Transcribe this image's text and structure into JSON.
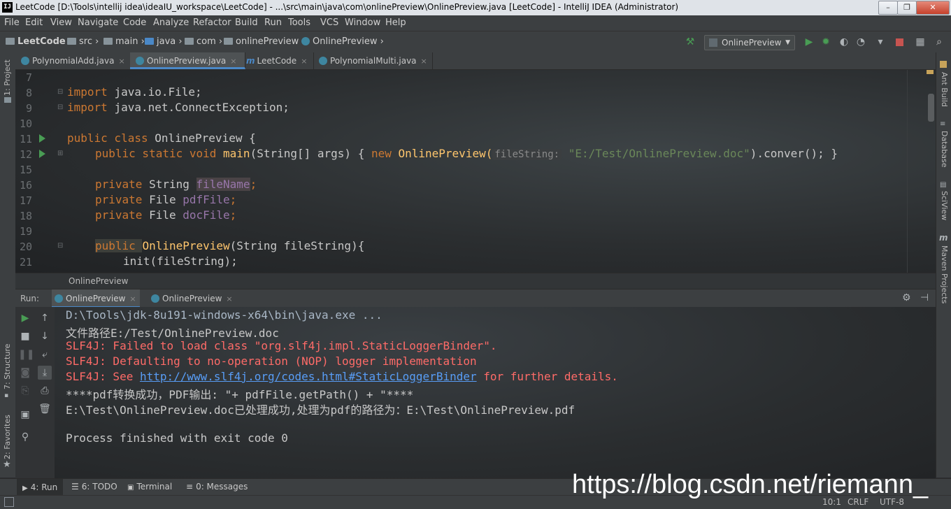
{
  "window": {
    "title": "LeetCode [D:\\Tools\\intellij idea\\ideaIU_workspace\\LeetCode] - ...\\src\\main\\java\\com\\onlinePreview\\OnlinePreview.java [LeetCode] - IntelliJ IDEA (Administrator)",
    "logo": "IJ",
    "minimize": "–",
    "restore": "❐",
    "close": "✕"
  },
  "menu": [
    "File",
    "Edit",
    "View",
    "Navigate",
    "Code",
    "Analyze",
    "Refactor",
    "Build",
    "Run",
    "Tools",
    "VCS",
    "Window",
    "Help"
  ],
  "breadcrumbs": [
    "LeetCode",
    "src",
    "main",
    "java",
    "com",
    "onlinePreview",
    "OnlinePreview"
  ],
  "run_config": "OnlinePreview",
  "left_tool_windows": [
    "1: Project",
    "7: Structure",
    "2: Favorites"
  ],
  "right_tool_windows": [
    "Ant Build",
    "Database",
    "SciView",
    "Maven Projects"
  ],
  "tabs": [
    {
      "label": "PolynomialAdd.java",
      "icon": "class-icon"
    },
    {
      "label": "OnlinePreview.java",
      "icon": "class-icon",
      "active": true
    },
    {
      "label": "LeetCode",
      "icon": "maven-icon"
    },
    {
      "label": "PolynomialMulti.java",
      "icon": "class-icon"
    }
  ],
  "editor": {
    "line_numbers": [
      "7",
      "8",
      "9",
      "10",
      "11",
      "12",
      "15",
      "16",
      "17",
      "18",
      "19",
      "20",
      "21"
    ],
    "lines": {
      "l8_kw": "import ",
      "l8_rest": "java.io.File;",
      "l9_kw": "import ",
      "l9_rest": "java.net.ConnectException;",
      "l11_kw": "public class ",
      "l11_rest": "OnlinePreview {",
      "l12_kw1": "public static void ",
      "l12_fn": "main",
      "l12_a": "(String[] args) { ",
      "l12_kw2": "new ",
      "l12_b": "OnlinePreview(",
      "l12_hint": "fileString:",
      "l12_str": "\"E:/Test/OnlinePreview.doc\"",
      "l12_c": ").conver(); }",
      "l16_kw": "private ",
      "l16_type": "String ",
      "l16_fld": "fileName",
      "l16_end": ";",
      "l17_kw": "private ",
      "l17_type": "File ",
      "l17_fld": "pdfFile",
      "l17_end": ";",
      "l18_kw": "private ",
      "l18_type": "File ",
      "l18_fld": "docFile",
      "l18_end": ";",
      "l20_kw": "public ",
      "l20_fn": "OnlinePreview",
      "l20_rest": "(String fileString){",
      "l21": "init(fileString);"
    }
  },
  "editor_breadcrumb": "OnlinePreview",
  "run_panel": {
    "label": "Run:",
    "tabs": [
      "OnlinePreview",
      "OnlinePreview"
    ],
    "console": [
      {
        "text": "D:\\Tools\\jdk-8u191-windows-x64\\bin\\java.exe ...",
        "kind": "cmd"
      },
      {
        "text": "文件路径E:/Test/OnlinePreview.doc",
        "kind": "out"
      },
      {
        "text": "SLF4J: Failed to load class \"org.slf4j.impl.StaticLoggerBinder\".",
        "kind": "err"
      },
      {
        "text": "SLF4J: Defaulting to no-operation (NOP) logger implementation",
        "kind": "err"
      },
      {
        "text": "SLF4J: See ",
        "kind": "err",
        "link": "http://www.slf4j.org/codes.html#StaticLoggerBinder",
        "tail": " for further details."
      },
      {
        "text": "****pdf转换成功，PDF输出: \"+ pdfFile.getPath() + \"****",
        "kind": "out"
      },
      {
        "text": "E:\\Test\\OnlinePreview.doc已处理成功,处理为pdf的路径为：E:\\Test\\OnlinePreview.pdf",
        "kind": "out"
      },
      {
        "text": "",
        "kind": "out"
      },
      {
        "text": "Process finished with exit code 0",
        "kind": "out"
      }
    ]
  },
  "bottom_tabs": [
    "4: Run",
    "6: TODO",
    "Terminal",
    "0: Messages"
  ],
  "status": {
    "position": "10:1",
    "line_sep": "CRLF",
    "encoding": "UTF-8"
  },
  "watermark": "https://blog.csdn.net/riemann_",
  "colors": {
    "keyword": "#cc7832",
    "function": "#ffc66d",
    "string": "#6a8759",
    "field": "#9876aa",
    "error": "#ff6b68",
    "link": "#589df6"
  }
}
